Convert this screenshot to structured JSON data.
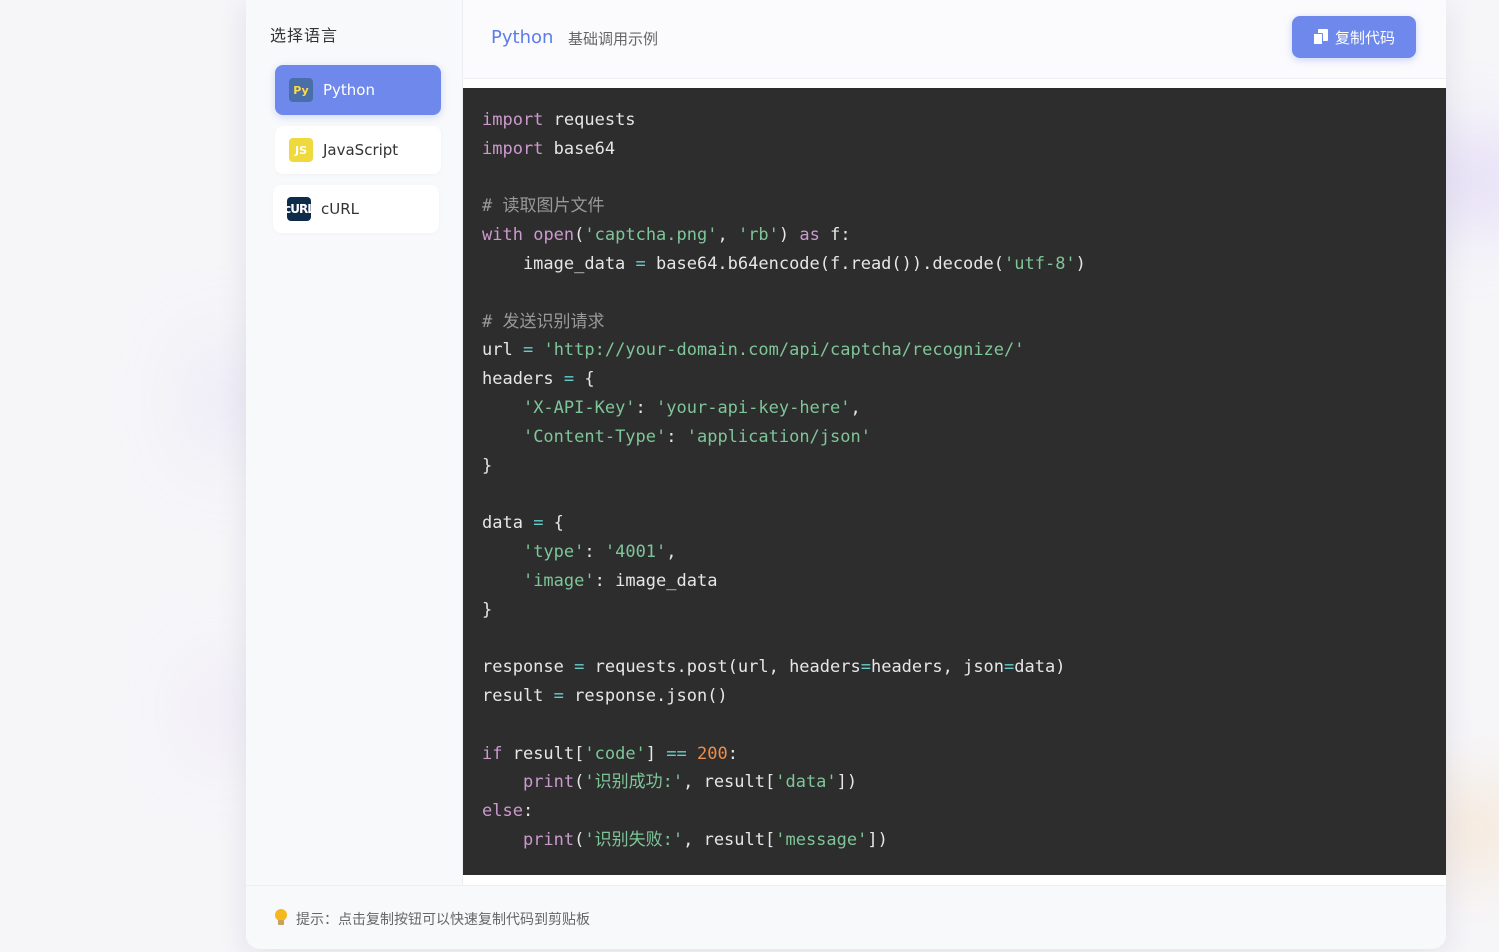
{
  "sidebar": {
    "title": "选择语言",
    "items": [
      {
        "badge": "Py",
        "label": "Python",
        "active": true
      },
      {
        "badge": "JS",
        "label": "JavaScript",
        "active": false
      },
      {
        "badge": "cURL",
        "label": "cURL",
        "active": false
      }
    ]
  },
  "header": {
    "language": "Python",
    "subtitle": "基础调用示例",
    "copy_label": "复制代码"
  },
  "code": {
    "lines": [
      [
        [
          "kw",
          "import"
        ],
        [
          "",
          " requests"
        ]
      ],
      [
        [
          "kw",
          "import"
        ],
        [
          "",
          " base64"
        ]
      ],
      [],
      [
        [
          "cmt",
          "# 读取图片文件"
        ]
      ],
      [
        [
          "kw",
          "with"
        ],
        [
          "",
          " "
        ],
        [
          "kw",
          "open"
        ],
        [
          "",
          "("
        ],
        [
          "str",
          "'captcha.png'"
        ],
        [
          "",
          ", "
        ],
        [
          "str",
          "'rb'"
        ],
        [
          "",
          ") "
        ],
        [
          "kw",
          "as"
        ],
        [
          "",
          " f:"
        ]
      ],
      [
        [
          "",
          "    image_data "
        ],
        [
          "op",
          "="
        ],
        [
          "",
          " base64.b64encode(f.read()).decode("
        ],
        [
          "str",
          "'utf-8'"
        ],
        [
          "",
          ")"
        ]
      ],
      [],
      [
        [
          "cmt",
          "# 发送识别请求"
        ]
      ],
      [
        [
          "",
          "url "
        ],
        [
          "op",
          "="
        ],
        [
          "",
          " "
        ],
        [
          "str",
          "'http://your-domain.com/api/captcha/recognize/'"
        ]
      ],
      [
        [
          "",
          "headers "
        ],
        [
          "op",
          "="
        ],
        [
          "",
          " {"
        ]
      ],
      [
        [
          "",
          "    "
        ],
        [
          "str",
          "'X-API-Key'"
        ],
        [
          "",
          ": "
        ],
        [
          "str",
          "'your-api-key-here'"
        ],
        [
          "",
          ","
        ]
      ],
      [
        [
          "",
          "    "
        ],
        [
          "str",
          "'Content-Type'"
        ],
        [
          "",
          ": "
        ],
        [
          "str",
          "'application/json'"
        ]
      ],
      [
        [
          "",
          "}"
        ]
      ],
      [],
      [
        [
          "",
          "data "
        ],
        [
          "op",
          "="
        ],
        [
          "",
          " {"
        ]
      ],
      [
        [
          "",
          "    "
        ],
        [
          "str",
          "'type'"
        ],
        [
          "",
          ": "
        ],
        [
          "str",
          "'4001'"
        ],
        [
          "",
          ","
        ]
      ],
      [
        [
          "",
          "    "
        ],
        [
          "str",
          "'image'"
        ],
        [
          "",
          ": image_data"
        ]
      ],
      [
        [
          "",
          "}"
        ]
      ],
      [],
      [
        [
          "",
          "response "
        ],
        [
          "op",
          "="
        ],
        [
          "",
          " requests.post(url, headers"
        ],
        [
          "op",
          "="
        ],
        [
          "",
          "headers, json"
        ],
        [
          "op",
          "="
        ],
        [
          "",
          "data)"
        ]
      ],
      [
        [
          "",
          "result "
        ],
        [
          "op",
          "="
        ],
        [
          "",
          " response.json()"
        ]
      ],
      [],
      [
        [
          "kw",
          "if"
        ],
        [
          "",
          " result["
        ],
        [
          "str",
          "'code'"
        ],
        [
          "",
          "] "
        ],
        [
          "op",
          "=="
        ],
        [
          "",
          " "
        ],
        [
          "num",
          "200"
        ],
        [
          "",
          ":"
        ]
      ],
      [
        [
          "",
          "    "
        ],
        [
          "kw",
          "print"
        ],
        [
          "",
          "("
        ],
        [
          "str",
          "'识别成功:'"
        ],
        [
          "",
          ", result["
        ],
        [
          "str",
          "'data'"
        ],
        [
          "",
          "])"
        ]
      ],
      [
        [
          "kw",
          "else"
        ],
        [
          "",
          ":"
        ]
      ],
      [
        [
          "",
          "    "
        ],
        [
          "kw",
          "print"
        ],
        [
          "",
          "("
        ],
        [
          "str",
          "'识别失败:'"
        ],
        [
          "",
          ", result["
        ],
        [
          "str",
          "'message'"
        ],
        [
          "",
          "])"
        ]
      ]
    ]
  },
  "footer": {
    "tip": "提示：点击复制按钮可以快速复制代码到剪贴板"
  },
  "colors": {
    "accent": "#6e88ec",
    "code_bg": "#2d2d2d",
    "keyword": "#cc99cd",
    "string": "#7ec699",
    "comment": "#999999",
    "number": "#f08d49"
  },
  "icons": {
    "copy": "copy-icon",
    "tip": "lightbulb-icon"
  }
}
